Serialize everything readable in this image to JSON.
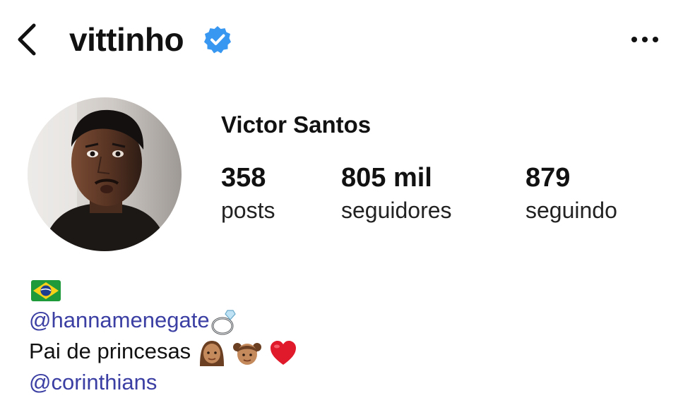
{
  "header": {
    "username": "vittinho",
    "verified": true,
    "icons": {
      "back": "chevron-left-icon",
      "verified": "verified-badge-icon",
      "more": "more-horizontal-icon"
    }
  },
  "profile": {
    "display_name": "Victor Santos",
    "stats": [
      {
        "value": "358",
        "label": "posts"
      },
      {
        "value": "805 mil",
        "label": "seguidores"
      },
      {
        "value": "879",
        "label": "seguindo"
      }
    ]
  },
  "bio": {
    "flag": "brazil-flag-emoji",
    "mention_partner": "@hannamenegate",
    "partner_emoji": "ring-emoji",
    "tagline": "Pai de princesas",
    "tagline_emojis": [
      "woman-medium-skin-emoji",
      "girl-medium-skin-emoji",
      "red-heart-emoji"
    ],
    "mention_club": "@corinthians"
  },
  "colors": {
    "link": "#3b3fa3",
    "verified_badge": "#3897f0",
    "text": "#111111"
  }
}
